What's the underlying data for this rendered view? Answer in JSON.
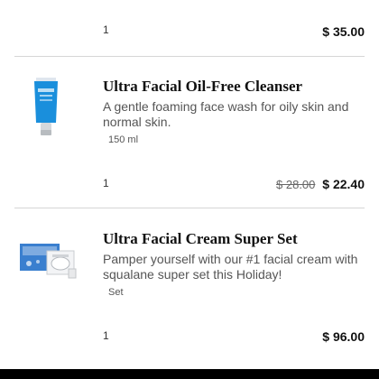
{
  "items": [
    {
      "quantity": "1",
      "price": "$ 35.00"
    },
    {
      "title": "Ultra Facial Oil-Free Cleanser",
      "description": "A gentle foaming face wash for oily skin and normal skin.",
      "size": "150 ml",
      "quantity": "1",
      "original_price": "$ 28.00",
      "price": "$ 22.40",
      "icon": "cleanser-tube-icon"
    },
    {
      "title": "Ultra Facial Cream Super Set",
      "description": "Pamper yourself with our #1 facial cream with squalane super set this Holiday!",
      "size": "Set",
      "quantity": "1",
      "price": "$ 96.00",
      "icon": "gift-set-icon"
    }
  ],
  "colors": {
    "tube_blue": "#1a8fdc",
    "set_blue": "#3a7fcf",
    "divider": "#d6d6d6"
  }
}
